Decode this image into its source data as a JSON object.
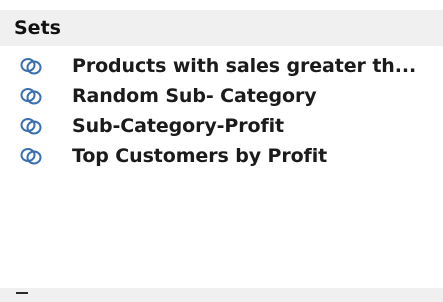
{
  "sets_section": {
    "header": "Sets",
    "items": [
      {
        "label": "Products with sales greater th...",
        "icon": "set-icon"
      },
      {
        "label": "Random Sub- Category",
        "icon": "set-icon"
      },
      {
        "label": "Sub-Category-Profit",
        "icon": "set-icon"
      },
      {
        "label": "Top Customers by Profit",
        "icon": "set-icon"
      }
    ]
  },
  "colors": {
    "icon": "#3a6fb0",
    "header_background": "#f0f0f0"
  }
}
